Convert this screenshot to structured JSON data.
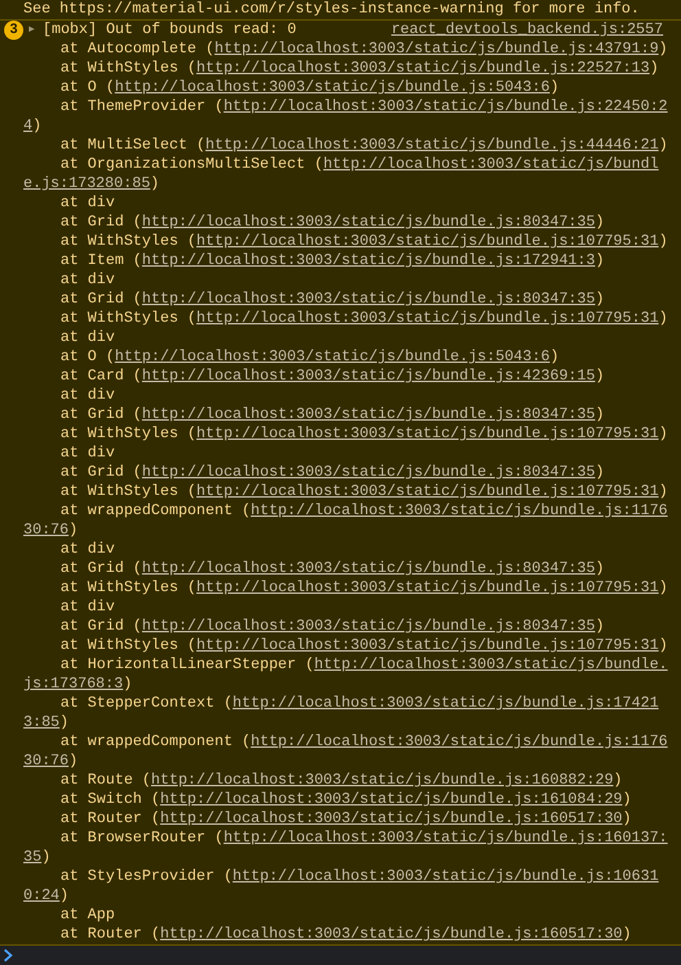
{
  "previous_message": "See https://material-ui.com/r/styles-instance-warning for more info.",
  "warning": {
    "count": "3",
    "expander": "▶",
    "expanded": false,
    "message": "[mobx] Out of bounds read: 0",
    "source": "react_devtools_backend.js:2557",
    "lines": [
      {
        "kind": "frame",
        "text": "at Autocomplete (",
        "link": "http://localhost:3003/static/js/bundle.js:43791:9",
        "after": ")"
      },
      {
        "kind": "frame",
        "text": "at WithStyles (",
        "link": "http://localhost:3003/static/js/bundle.js:22527:13",
        "after": ")"
      },
      {
        "kind": "frame",
        "text": "at O (",
        "link": "http://localhost:3003/static/js/bundle.js:5043:6",
        "after": ")"
      },
      {
        "kind": "frame",
        "text": "at ThemeProvider (",
        "link": "http://localhost:3003/static/js/bundle.js:22450:2"
      },
      {
        "kind": "continuation",
        "link": "4",
        "after": ")"
      },
      {
        "kind": "frame",
        "text": "at MultiSelect (",
        "link": "http://localhost:3003/static/js/bundle.js:44446:21",
        "after": ")"
      },
      {
        "kind": "frame",
        "text": "at OrganizationsMultiSelect (",
        "link": "http://localhost:3003/static/js/bundl"
      },
      {
        "kind": "continuation",
        "link": "e.js:173280:85",
        "after": ")"
      },
      {
        "kind": "frame",
        "text": "at div"
      },
      {
        "kind": "frame",
        "text": "at Grid (",
        "link": "http://localhost:3003/static/js/bundle.js:80347:35",
        "after": ")"
      },
      {
        "kind": "frame",
        "text": "at WithStyles (",
        "link": "http://localhost:3003/static/js/bundle.js:107795:31",
        "after": ")"
      },
      {
        "kind": "frame",
        "text": "at Item (",
        "link": "http://localhost:3003/static/js/bundle.js:172941:3",
        "after": ")"
      },
      {
        "kind": "frame",
        "text": "at div"
      },
      {
        "kind": "frame",
        "text": "at Grid (",
        "link": "http://localhost:3003/static/js/bundle.js:80347:35",
        "after": ")"
      },
      {
        "kind": "frame",
        "text": "at WithStyles (",
        "link": "http://localhost:3003/static/js/bundle.js:107795:31",
        "after": ")"
      },
      {
        "kind": "frame",
        "text": "at div"
      },
      {
        "kind": "frame",
        "text": "at O (",
        "link": "http://localhost:3003/static/js/bundle.js:5043:6",
        "after": ")"
      },
      {
        "kind": "frame",
        "text": "at Card (",
        "link": "http://localhost:3003/static/js/bundle.js:42369:15",
        "after": ")"
      },
      {
        "kind": "frame",
        "text": "at div"
      },
      {
        "kind": "frame",
        "text": "at Grid (",
        "link": "http://localhost:3003/static/js/bundle.js:80347:35",
        "after": ")"
      },
      {
        "kind": "frame",
        "text": "at WithStyles (",
        "link": "http://localhost:3003/static/js/bundle.js:107795:31",
        "after": ")"
      },
      {
        "kind": "frame",
        "text": "at div"
      },
      {
        "kind": "frame",
        "text": "at Grid (",
        "link": "http://localhost:3003/static/js/bundle.js:80347:35",
        "after": ")"
      },
      {
        "kind": "frame",
        "text": "at WithStyles (",
        "link": "http://localhost:3003/static/js/bundle.js:107795:31",
        "after": ")"
      },
      {
        "kind": "frame",
        "text": "at wrappedComponent (",
        "link": "http://localhost:3003/static/js/bundle.js:1176"
      },
      {
        "kind": "continuation",
        "link": "30:76",
        "after": ")"
      },
      {
        "kind": "frame",
        "text": "at div"
      },
      {
        "kind": "frame",
        "text": "at Grid (",
        "link": "http://localhost:3003/static/js/bundle.js:80347:35",
        "after": ")"
      },
      {
        "kind": "frame",
        "text": "at WithStyles (",
        "link": "http://localhost:3003/static/js/bundle.js:107795:31",
        "after": ")"
      },
      {
        "kind": "frame",
        "text": "at div"
      },
      {
        "kind": "frame",
        "text": "at Grid (",
        "link": "http://localhost:3003/static/js/bundle.js:80347:35",
        "after": ")"
      },
      {
        "kind": "frame",
        "text": "at WithStyles (",
        "link": "http://localhost:3003/static/js/bundle.js:107795:31",
        "after": ")"
      },
      {
        "kind": "frame",
        "text": "at HorizontalLinearStepper (",
        "link": "http://localhost:3003/static/js/bundle."
      },
      {
        "kind": "continuation",
        "link": "js:173768:3",
        "after": ")"
      },
      {
        "kind": "frame",
        "text": "at StepperContext (",
        "link": "http://localhost:3003/static/js/bundle.js:17421"
      },
      {
        "kind": "continuation",
        "link": "3:85",
        "after": ")"
      },
      {
        "kind": "frame",
        "text": "at wrappedComponent (",
        "link": "http://localhost:3003/static/js/bundle.js:1176"
      },
      {
        "kind": "continuation",
        "link": "30:76",
        "after": ")"
      },
      {
        "kind": "frame",
        "text": "at Route (",
        "link": "http://localhost:3003/static/js/bundle.js:160882:29",
        "after": ")"
      },
      {
        "kind": "frame",
        "text": "at Switch (",
        "link": "http://localhost:3003/static/js/bundle.js:161084:29",
        "after": ")"
      },
      {
        "kind": "frame",
        "text": "at Router (",
        "link": "http://localhost:3003/static/js/bundle.js:160517:30",
        "after": ")"
      },
      {
        "kind": "frame",
        "text": "at BrowserRouter (",
        "link": "http://localhost:3003/static/js/bundle.js:160137:"
      },
      {
        "kind": "continuation",
        "link": "35",
        "after": ")"
      },
      {
        "kind": "frame",
        "text": "at StylesProvider (",
        "link": "http://localhost:3003/static/js/bundle.js:10631"
      },
      {
        "kind": "continuation",
        "link": "0:24",
        "after": ")"
      },
      {
        "kind": "frame",
        "text": "at App"
      },
      {
        "kind": "frame",
        "text": "at Router (",
        "link": "http://localhost:3003/static/js/bundle.js:160517:30",
        "after": ")"
      }
    ]
  }
}
